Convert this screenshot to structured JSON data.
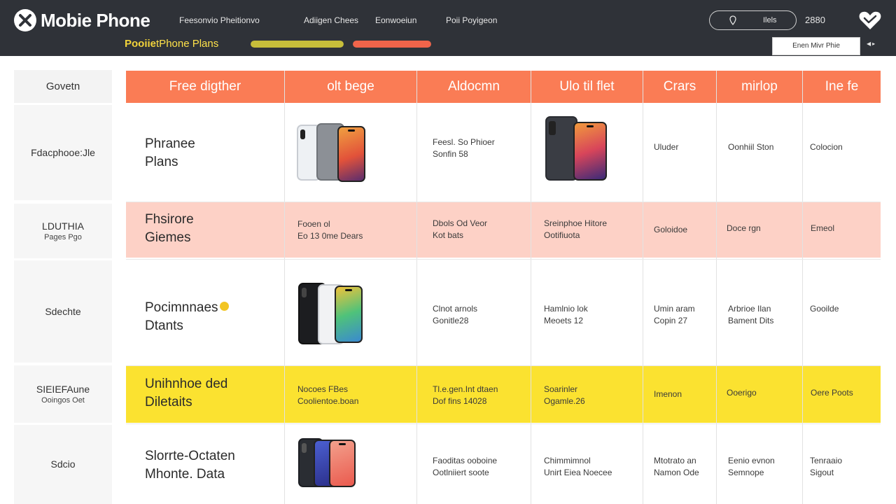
{
  "app": {
    "title": "Mobie Phone"
  },
  "nav": [
    "Feesonvio Pheitionvo",
    "Adiigen Chees",
    "Eonwoeiun",
    "Poii Poyigeon"
  ],
  "subtitle": {
    "main": "Pooiie",
    "alt": "tPhone Plans"
  },
  "progress": [
    {
      "fraction": 1.0,
      "color": "#c7be3a"
    },
    {
      "fraction": 1.0,
      "color": "#f0644a"
    }
  ],
  "header_pill": {
    "label": "Ilels",
    "icon": "pin-icon"
  },
  "header_count": "2880",
  "heart_icon": "heart-icon",
  "dropdown": {
    "label": "Enen Mivr Phie"
  },
  "table": {
    "corner_label": "Govetn",
    "columns": [
      "Free digther",
      "olt bege",
      "Aldocmn",
      "Ulo til flet",
      "Crars",
      "mirlop",
      "Ine fe"
    ],
    "rows": [
      {
        "side": [
          "Fdacphooe:Jle",
          ""
        ],
        "title": [
          "Phranee",
          "Plans"
        ],
        "title_dot": false,
        "highlight": "#ffffff",
        "cells": [
          [
            "",
            ""
          ],
          [
            "Feesl. So Phioer",
            "Sonfin 58"
          ],
          [
            "",
            ""
          ],
          [
            "Uluder",
            ""
          ],
          [
            "Oonhiil Ston",
            ""
          ],
          [
            "Colocion",
            ""
          ]
        ]
      },
      {
        "side": [
          "LDUTHIA",
          "Pages Pgo"
        ],
        "title": [
          "Fhsirore",
          "Giemes"
        ],
        "title_dot": true,
        "highlight": "#fdd1c6",
        "cells": [
          [
            "Fooen ol",
            "Eo 13 0me Dears"
          ],
          [
            "Dbols Od Veor",
            "Kot bats"
          ],
          [
            "Sreinphoe Hitore",
            "Ootifiuota"
          ],
          [
            "Goloidoe",
            ""
          ],
          [
            "Doce rgn",
            ""
          ],
          [
            "Emeol",
            ""
          ]
        ]
      },
      {
        "side": [
          "Sdechte",
          ""
        ],
        "title": [
          "Pocimnnaes",
          "Dtants"
        ],
        "title_dot": true,
        "highlight": "#ffffff",
        "cells": [
          [
            "",
            ""
          ],
          [
            "Clnot arnols",
            "Gonitle28"
          ],
          [
            "Hamlnio lok",
            "Meoets 12"
          ],
          [
            "Umin aram",
            "Copin 27"
          ],
          [
            "Arbrioe Ilan",
            "Bament Dits"
          ],
          [
            "Gooilde",
            ""
          ]
        ]
      },
      {
        "side": [
          "SIEIEFAune",
          "Ooingos Oet"
        ],
        "title": [
          "Unihnhoe ded",
          "Diletaits"
        ],
        "title_dot": false,
        "highlight": "#fbe230",
        "cells": [
          [
            "Nocoes FBes",
            "Coolientoe.boan"
          ],
          [
            "Tl.e.gen.Int dtaen",
            "Dof fins 14028"
          ],
          [
            "Soarinler",
            "Ogamle.26"
          ],
          [
            "Imenon",
            ""
          ],
          [
            "Ooerigo",
            ""
          ],
          [
            "Oere Poots",
            ""
          ]
        ]
      },
      {
        "side": [
          "Sdcio",
          ""
        ],
        "title": [
          "Slorrte-Octaten",
          "Mhonte. Data"
        ],
        "title_dot": false,
        "highlight": "#ffffff",
        "cells": [
          [
            "",
            ""
          ],
          [
            "Faoditas ooboine",
            "Ootlniiert soote"
          ],
          [
            "Chimmimnol",
            "Unirt Eiea Noecee"
          ],
          [
            "Mtotrato an",
            "Namon Ode"
          ],
          [
            "Eenio evnon",
            "Semnope"
          ],
          [
            "Tenraaio",
            "Sigout"
          ]
        ]
      }
    ]
  },
  "phone_images": [
    {
      "row": 0,
      "col": 0,
      "name": "phone-image-silver-grey-orange"
    },
    {
      "row": 0,
      "col": 2,
      "name": "phone-image-dark-purple-orange"
    },
    {
      "row": 2,
      "col": 0,
      "name": "phone-image-black-white-green"
    },
    {
      "row": 4,
      "col": 0,
      "name": "phone-image-dark-blue-coral"
    }
  ]
}
